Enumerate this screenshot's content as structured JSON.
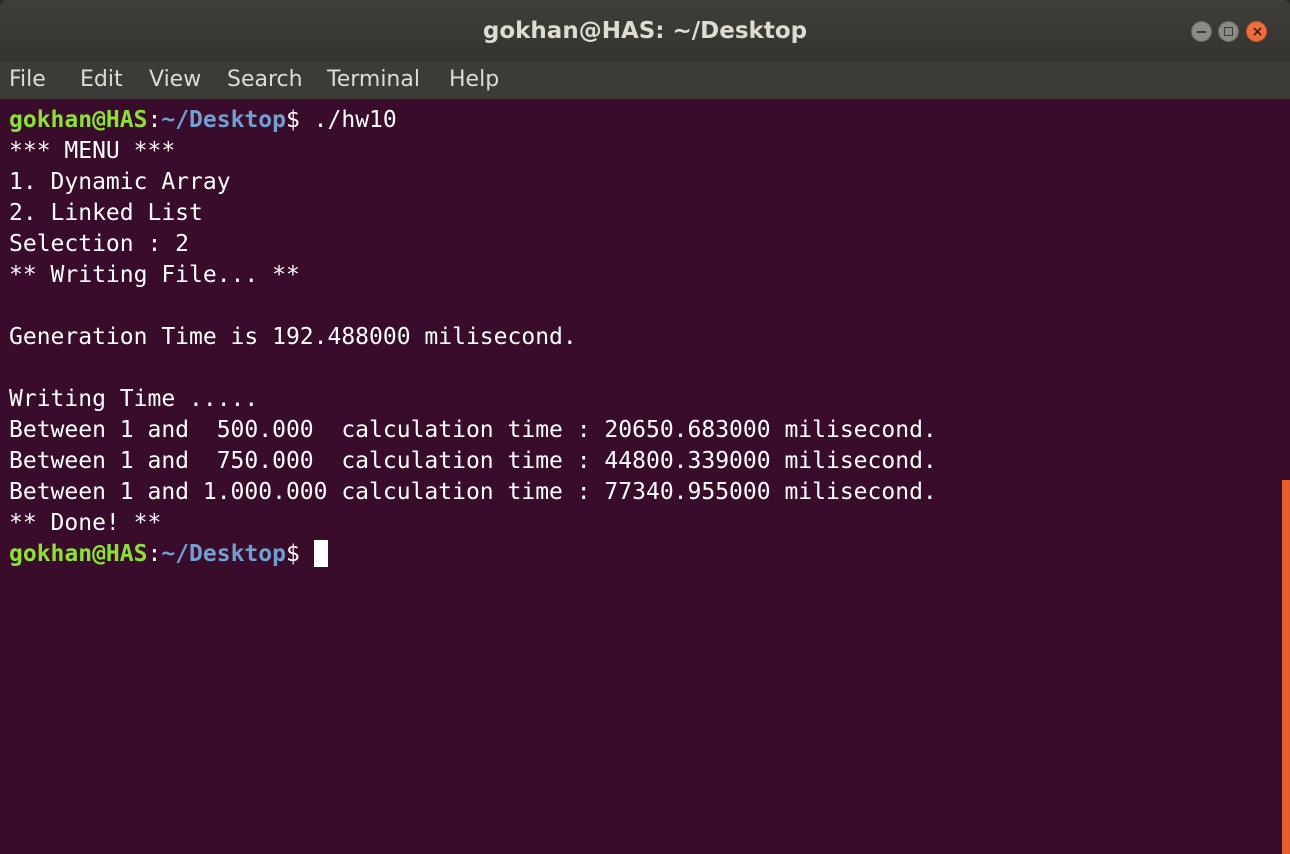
{
  "window": {
    "title": "gokhan@HAS: ~/Desktop"
  },
  "menubar": {
    "items": [
      "File",
      "Edit",
      "View",
      "Search",
      "Terminal",
      "Help"
    ]
  },
  "terminal": {
    "prompt": {
      "user_host": "gokhan@HAS",
      "separator": ":",
      "path": "~/Desktop",
      "symbol": "$ "
    },
    "command": "./hw10",
    "output": [
      "*** MENU ***",
      "1. Dynamic Array",
      "2. Linked List",
      "Selection : 2",
      "** Writing File... **",
      "",
      "Generation Time is 192.488000 milisecond.",
      "",
      "Writing Time .....",
      "Between 1 and  500.000  calculation time : 20650.683000 milisecond.",
      "Between 1 and  750.000  calculation time : 44800.339000 milisecond.",
      "Between 1 and 1.000.000 calculation time : 77340.955000 milisecond.",
      "** Done! **"
    ]
  },
  "colors": {
    "terminal_background": "#380c2a",
    "prompt_user": "#8ae234",
    "prompt_path": "#729fcf",
    "text": "#ffffff",
    "scrollbar_thumb": "#e2602f",
    "close_button": "#ef6c3e"
  },
  "icons": {
    "minimize": "minimize-icon",
    "maximize": "maximize-icon",
    "close": "close-icon"
  }
}
